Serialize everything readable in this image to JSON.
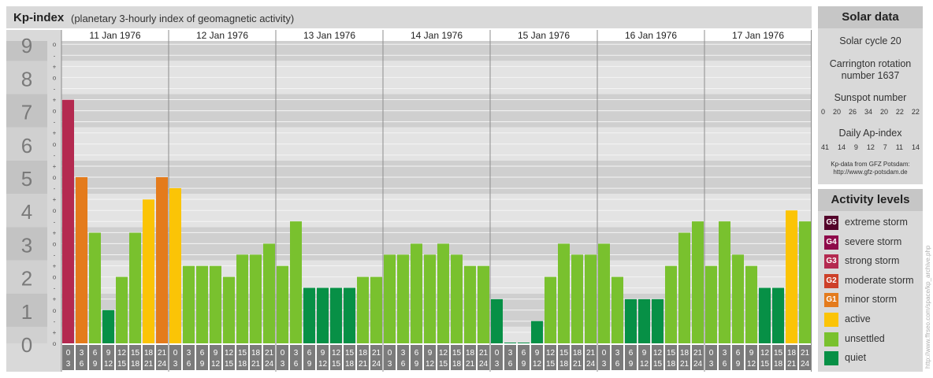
{
  "header": {
    "title": "Kp-index",
    "subtitle": "(planetary 3-hourly index of geomagnetic activity)"
  },
  "chart_data": {
    "type": "bar",
    "title": "Kp-index",
    "subtitle": "(planetary 3-hourly index of geomagnetic activity)",
    "ylim": [
      0,
      9
    ],
    "y_ticks": [
      "0",
      "1",
      "2",
      "3",
      "4",
      "5",
      "6",
      "7",
      "8",
      "9"
    ],
    "y_minor_marks": [
      "o",
      "+",
      "-"
    ],
    "grid": true,
    "days": [
      "11 Jan 1976",
      "12 Jan 1976",
      "13 Jan 1976",
      "14 Jan 1976",
      "15 Jan 1976",
      "16 Jan 1976",
      "17 Jan 1976"
    ],
    "interval_labels": [
      [
        "0",
        "3"
      ],
      [
        "3",
        "6"
      ],
      [
        "6",
        "9"
      ],
      [
        "9",
        "12"
      ],
      [
        "12",
        "15"
      ],
      [
        "15",
        "18"
      ],
      [
        "18",
        "21"
      ],
      [
        "21",
        "24"
      ]
    ],
    "values": [
      [
        7.33,
        5.0,
        3.33,
        1.0,
        2.0,
        3.33,
        4.33,
        5.0
      ],
      [
        4.67,
        2.33,
        2.33,
        2.33,
        2.0,
        2.67,
        2.67,
        3.0
      ],
      [
        2.33,
        3.67,
        1.67,
        1.67,
        1.67,
        1.67,
        2.0,
        2.0
      ],
      [
        2.67,
        2.67,
        3.0,
        2.67,
        3.0,
        2.67,
        2.33,
        2.33
      ],
      [
        1.33,
        0.0,
        0.0,
        0.67,
        2.0,
        3.0,
        2.67,
        2.67
      ],
      [
        3.0,
        2.0,
        1.33,
        1.33,
        1.33,
        2.33,
        3.33,
        3.67
      ],
      [
        2.33,
        3.67,
        2.67,
        2.33,
        1.67,
        1.67,
        4.0,
        3.67
      ]
    ],
    "colors": {
      "quiet": "#079046",
      "unsettled": "#79c12e",
      "active": "#fbc406",
      "G1": "#e47b1c",
      "G2": "#cd4029",
      "G3": "#b42a50",
      "G4": "#b8005c",
      "G5": "#54032a"
    },
    "background": {
      "band_dark": "#cfcfcf",
      "band_light": "#e3e3e3",
      "axis_bg": "#d9d9d9",
      "gridline": "#f4f4f4"
    }
  },
  "solar": {
    "header": "Solar data",
    "cycle": "Solar cycle 20",
    "carrington_line1": "Carrington rotation",
    "carrington_line2": "number 1637",
    "sunspot_label": "Sunspot number",
    "sunspot_values": [
      "0",
      "20",
      "26",
      "34",
      "20",
      "22",
      "22"
    ],
    "ap_label": "Daily Ap-index",
    "ap_values": [
      "41",
      "14",
      "9",
      "12",
      "7",
      "11",
      "14"
    ],
    "source_line1": "Kp-data from GFZ Potsdam:",
    "source_line2": "http://www.gfz-potsdam.de"
  },
  "activity": {
    "header": "Activity levels",
    "items": [
      {
        "badge": "G5",
        "label": "extreme storm",
        "color": "#54032a"
      },
      {
        "badge": "G4",
        "label": "severe storm",
        "color": "#8e0a4a"
      },
      {
        "badge": "G3",
        "label": "strong storm",
        "color": "#b42a50"
      },
      {
        "badge": "G2",
        "label": "moderate storm",
        "color": "#cd4029"
      },
      {
        "badge": "G1",
        "label": "minor storm",
        "color": "#e47b1c"
      },
      {
        "badge": "",
        "label": "active",
        "color": "#fbc406"
      },
      {
        "badge": "",
        "label": "unsettled",
        "color": "#79c12e"
      },
      {
        "badge": "",
        "label": "quiet",
        "color": "#079046"
      }
    ]
  },
  "credit": "http://www.ffrseo.com/space/kp_archive.php"
}
